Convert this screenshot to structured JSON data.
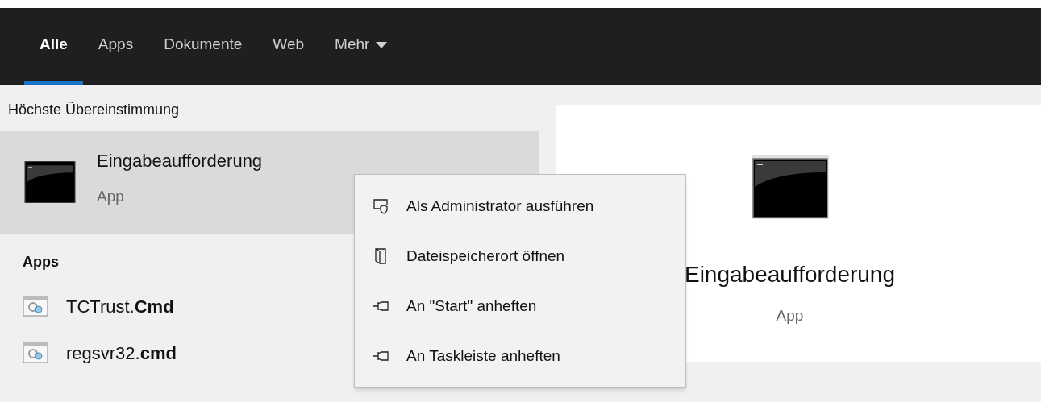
{
  "tabs": [
    {
      "label": "Alle",
      "selected": true
    },
    {
      "label": "Apps",
      "selected": false
    },
    {
      "label": "Dokumente",
      "selected": false
    },
    {
      "label": "Web",
      "selected": false
    },
    {
      "label": "Mehr",
      "selected": false,
      "kind": "dropdown"
    }
  ],
  "best_match": {
    "heading": "Höchste Übereinstimmung",
    "title": "Eingabeaufforderung",
    "subtitle": "App",
    "selected": true
  },
  "apps": {
    "heading": "Apps",
    "items": [
      {
        "label": "TCTrust.**Cmd**"
      },
      {
        "label": "regsvr32.**cmd**"
      }
    ]
  },
  "context_menu": [
    {
      "kind": "admin",
      "label": "Als Administrator ausführen"
    },
    {
      "kind": "folder",
      "label": "Dateispeicherort öffnen"
    },
    {
      "kind": "pin",
      "label": "An \"Start\" anheften"
    },
    {
      "kind": "pin",
      "label": "An Taskleiste anheften"
    }
  ],
  "preview": {
    "title": "Eingabeaufforderung",
    "subtitle": "App"
  }
}
